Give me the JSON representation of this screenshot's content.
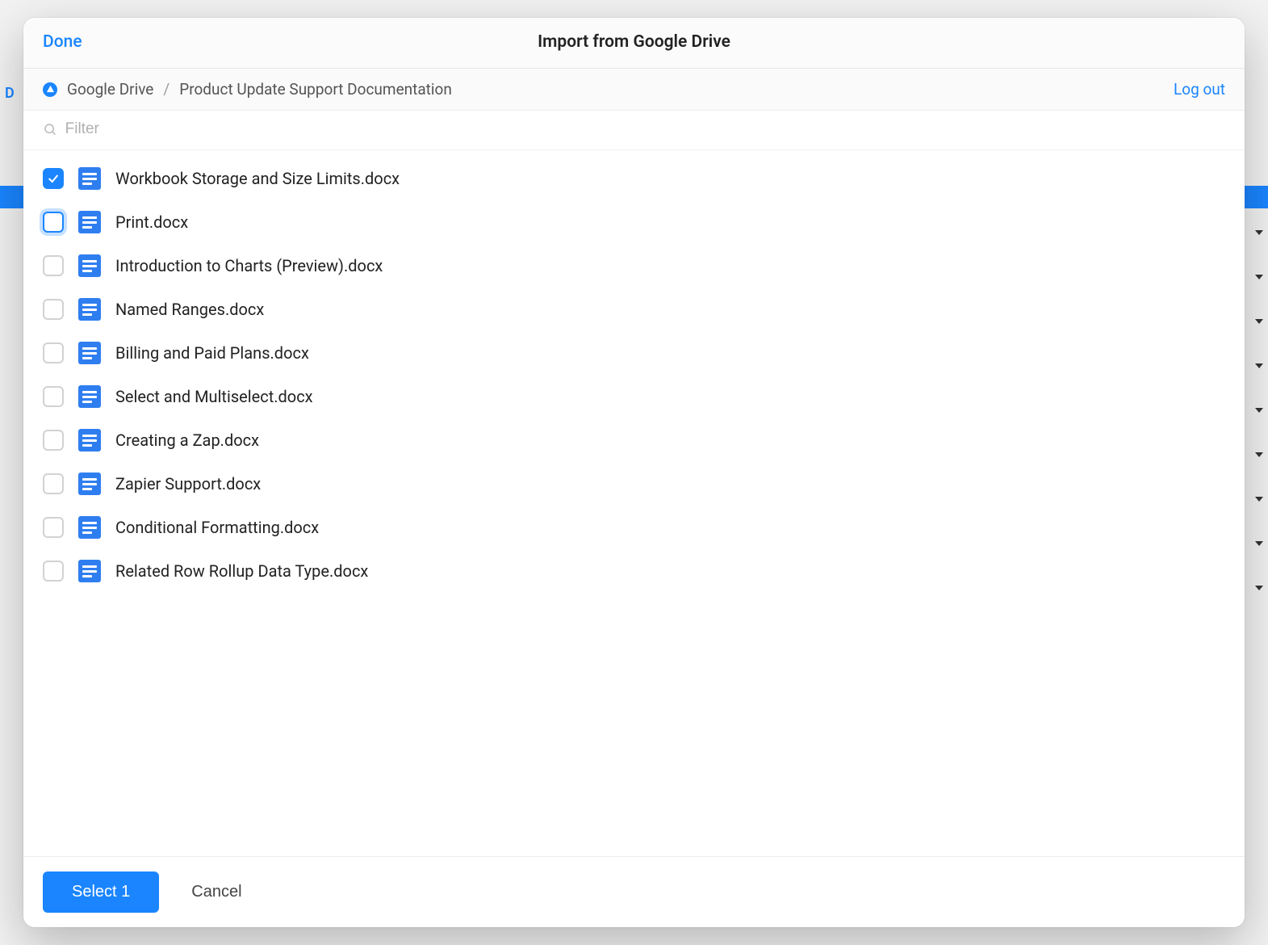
{
  "backdrop": {
    "partial_label": "D"
  },
  "header": {
    "done_label": "Done",
    "title": "Import from Google Drive"
  },
  "breadcrumb": {
    "root": "Google Drive",
    "separator": "/",
    "current": "Product Update Support Documentation",
    "logout_label": "Log out"
  },
  "filter": {
    "placeholder": "Filter"
  },
  "files": [
    {
      "name": "Workbook Storage and Size Limits.docx",
      "checked": true,
      "focused": false
    },
    {
      "name": "Print.docx",
      "checked": false,
      "focused": true
    },
    {
      "name": "Introduction to Charts (Preview).docx",
      "checked": false,
      "focused": false
    },
    {
      "name": "Named Ranges.docx",
      "checked": false,
      "focused": false
    },
    {
      "name": "Billing and Paid Plans.docx",
      "checked": false,
      "focused": false
    },
    {
      "name": "Select and Multiselect.docx",
      "checked": false,
      "focused": false
    },
    {
      "name": "Creating a Zap.docx",
      "checked": false,
      "focused": false
    },
    {
      "name": "Zapier Support.docx",
      "checked": false,
      "focused": false
    },
    {
      "name": "Conditional Formatting.docx",
      "checked": false,
      "focused": false
    },
    {
      "name": "Related Row Rollup Data Type.docx",
      "checked": false,
      "focused": false
    }
  ],
  "footer": {
    "select_label": "Select 1",
    "cancel_label": "Cancel"
  }
}
